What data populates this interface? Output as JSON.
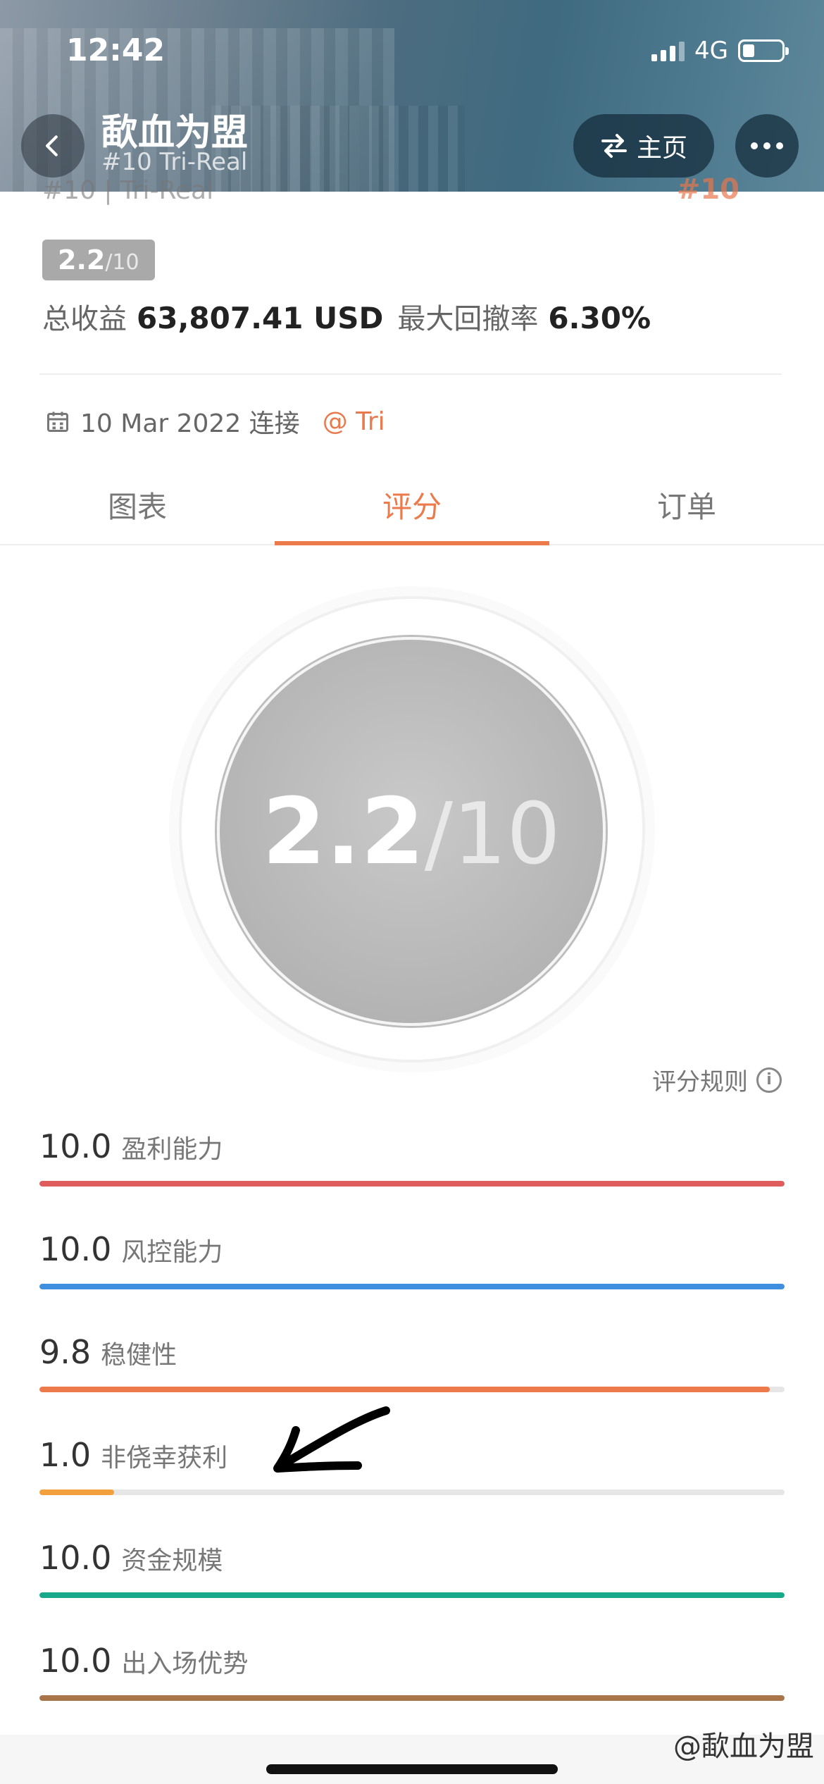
{
  "status_bar": {
    "time": "12:42",
    "network": "4G"
  },
  "header": {
    "title": "歃血为盟",
    "subtitle": "#10 Tri-Real",
    "home_label": "主页"
  },
  "summary": {
    "peek_left": "#10 | Tri-Real",
    "peek_right": "#10",
    "score_main": "2.2",
    "score_den": "/10",
    "total_profit_label": "总收益",
    "total_profit_value": "63,807.41 USD",
    "max_drawdown_label": "最大回撤率",
    "max_drawdown_value": "6.30%",
    "connected_date": "10 Mar 2022 连接",
    "owner": "@ Tri"
  },
  "tabs": [
    {
      "label": "图表"
    },
    {
      "label": "评分"
    },
    {
      "label": "订单"
    }
  ],
  "active_tab": "评分",
  "score_circle": {
    "main": "2.2",
    "den": "/10"
  },
  "rules_label": "评分规则",
  "metrics": [
    {
      "value": "10.0",
      "label": "盈利能力",
      "fraction": 1.0,
      "color": "#e05d5d"
    },
    {
      "value": "10.0",
      "label": "风控能力",
      "fraction": 1.0,
      "color": "#3f8fe0"
    },
    {
      "value": "9.8",
      "label": "稳健性",
      "fraction": 0.98,
      "color": "#ec7a4b"
    },
    {
      "value": "1.0",
      "label": "非侥幸获利",
      "fraction": 0.1,
      "color": "#f2a03d"
    },
    {
      "value": "10.0",
      "label": "资金规模",
      "fraction": 1.0,
      "color": "#17a88a"
    },
    {
      "value": "10.0",
      "label": "出入场优势",
      "fraction": 1.0,
      "color": "#a8744a"
    }
  ],
  "watermark": "@歃血为盟"
}
